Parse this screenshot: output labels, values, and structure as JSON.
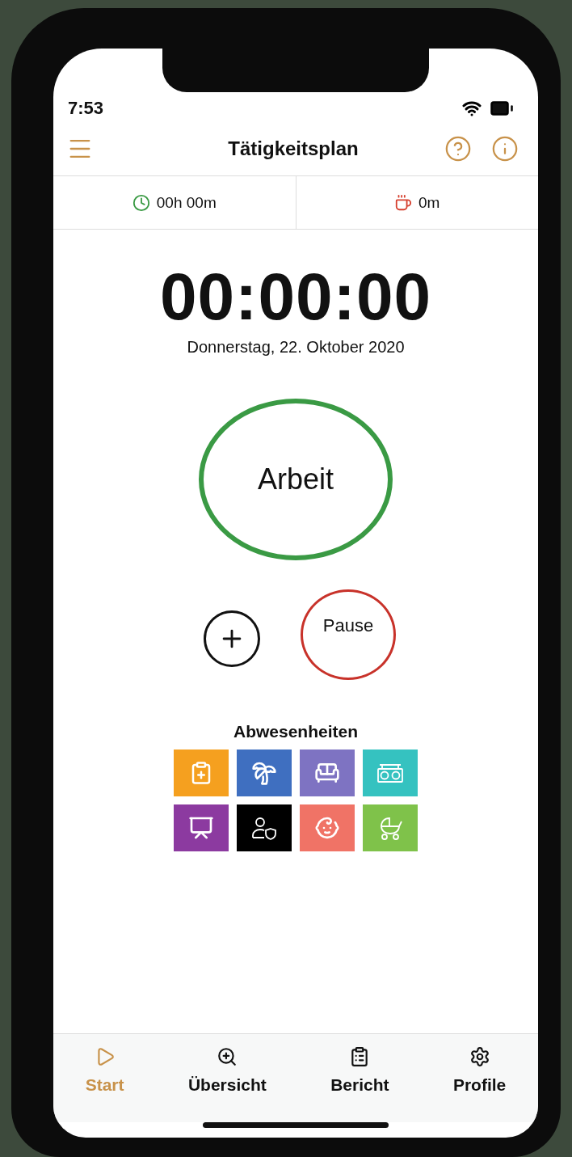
{
  "status_bar": {
    "time": "7:53"
  },
  "header": {
    "title": "Tätigkeitsplan"
  },
  "summary": [
    {
      "kind": "work",
      "value": "00h 00m"
    },
    {
      "kind": "break",
      "value": "0m"
    }
  ],
  "timer": {
    "display": "00:00:00",
    "date": "Donnerstag, 22. Oktober 2020"
  },
  "actions": {
    "work": "Arbeit",
    "pause": "Pause"
  },
  "absences": {
    "title": "Abwesenheiten",
    "tiles": [
      {
        "kind": "sick",
        "color": "#f5a01f"
      },
      {
        "kind": "vacation",
        "color": "#3f6fc0"
      },
      {
        "kind": "free",
        "color": "#7e73c2"
      },
      {
        "kind": "overtime",
        "color": "#35c2c0"
      },
      {
        "kind": "training",
        "color": "#8c3aa0"
      },
      {
        "kind": "protected",
        "color": "#000000"
      },
      {
        "kind": "child",
        "color": "#f07366"
      },
      {
        "kind": "parental",
        "color": "#7fc24a"
      }
    ]
  },
  "nav": [
    {
      "kind": "start",
      "label": "Start",
      "selected": true
    },
    {
      "kind": "overview",
      "label": "Übersicht",
      "selected": false
    },
    {
      "kind": "report",
      "label": "Bericht",
      "selected": false
    },
    {
      "kind": "profile",
      "label": "Profile",
      "selected": false
    }
  ]
}
